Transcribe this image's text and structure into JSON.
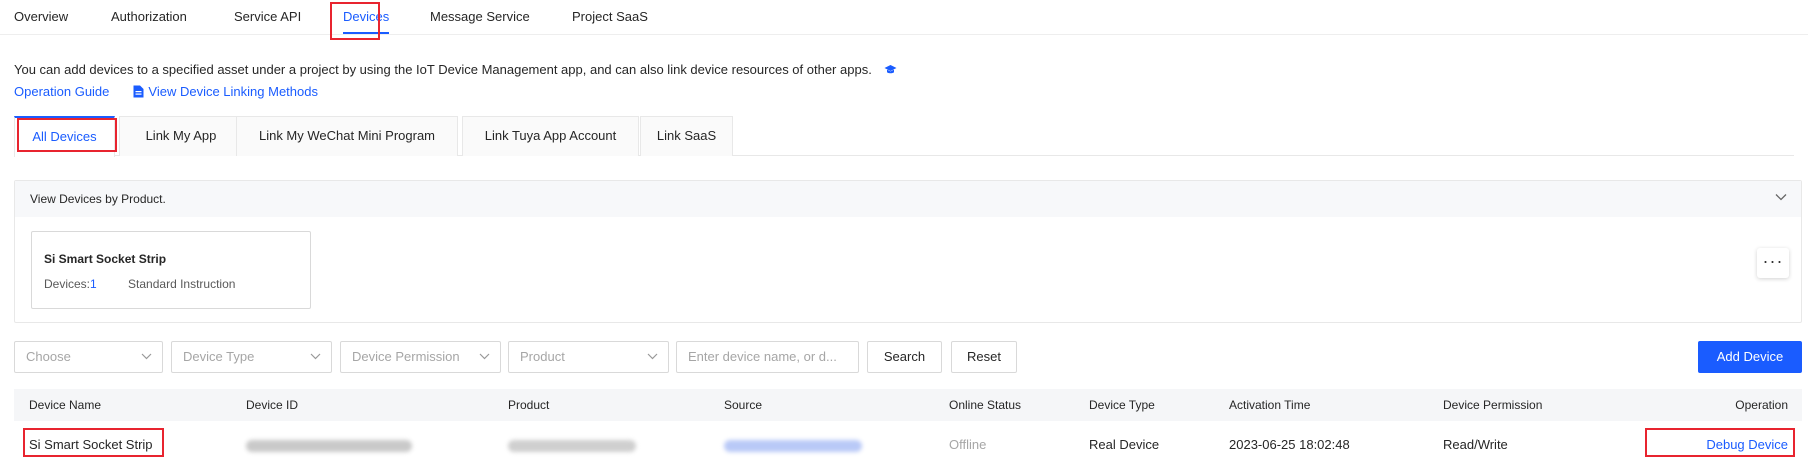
{
  "top_nav": {
    "tabs": [
      {
        "label": "Overview"
      },
      {
        "label": "Authorization"
      },
      {
        "label": "Service API"
      },
      {
        "label": "Devices"
      },
      {
        "label": "Message Service"
      },
      {
        "label": "Project SaaS"
      }
    ],
    "active": "Devices"
  },
  "intro": {
    "text": "You can add devices to a specified asset under a project by using the IoT Device Management app, and can also link device resources of other apps.",
    "operation_guide": "Operation Guide",
    "linking_methods": "View Device Linking Methods"
  },
  "sub_tabs": [
    {
      "label": "All Devices"
    },
    {
      "label": "Link My App"
    },
    {
      "label": "Link My WeChat Mini Program"
    },
    {
      "label": "Link Tuya App Account"
    },
    {
      "label": "Link SaaS"
    }
  ],
  "product_panel": {
    "title": "View Devices by Product.",
    "card": {
      "name": "Si Smart Socket Strip",
      "devices_label": "Devices:",
      "devices_count": "1",
      "instruction": "Standard Instruction"
    },
    "more_label": "···"
  },
  "filters": {
    "choose_placeholder": "Choose",
    "device_type_placeholder": "Device Type",
    "device_permission_placeholder": "Device Permission",
    "product_placeholder": "Product",
    "search_placeholder": "Enter device name, or d...",
    "search_label": "Search",
    "reset_label": "Reset",
    "add_device_label": "Add Device"
  },
  "table": {
    "columns": [
      "Device Name",
      "Device ID",
      "Product",
      "Source",
      "Online Status",
      "Device Type",
      "Activation Time",
      "Device Permission",
      "Operation"
    ],
    "rows": [
      {
        "device_name": "Si Smart Socket Strip",
        "online_status": "Offline",
        "device_type": "Real Device",
        "activation_time": "2023-06-25 18:02:48",
        "device_permission": "Read/Write",
        "operation": "Debug Device"
      }
    ]
  },
  "colors": {
    "accent": "#1a5cff",
    "highlight_box": "#e8242f"
  }
}
